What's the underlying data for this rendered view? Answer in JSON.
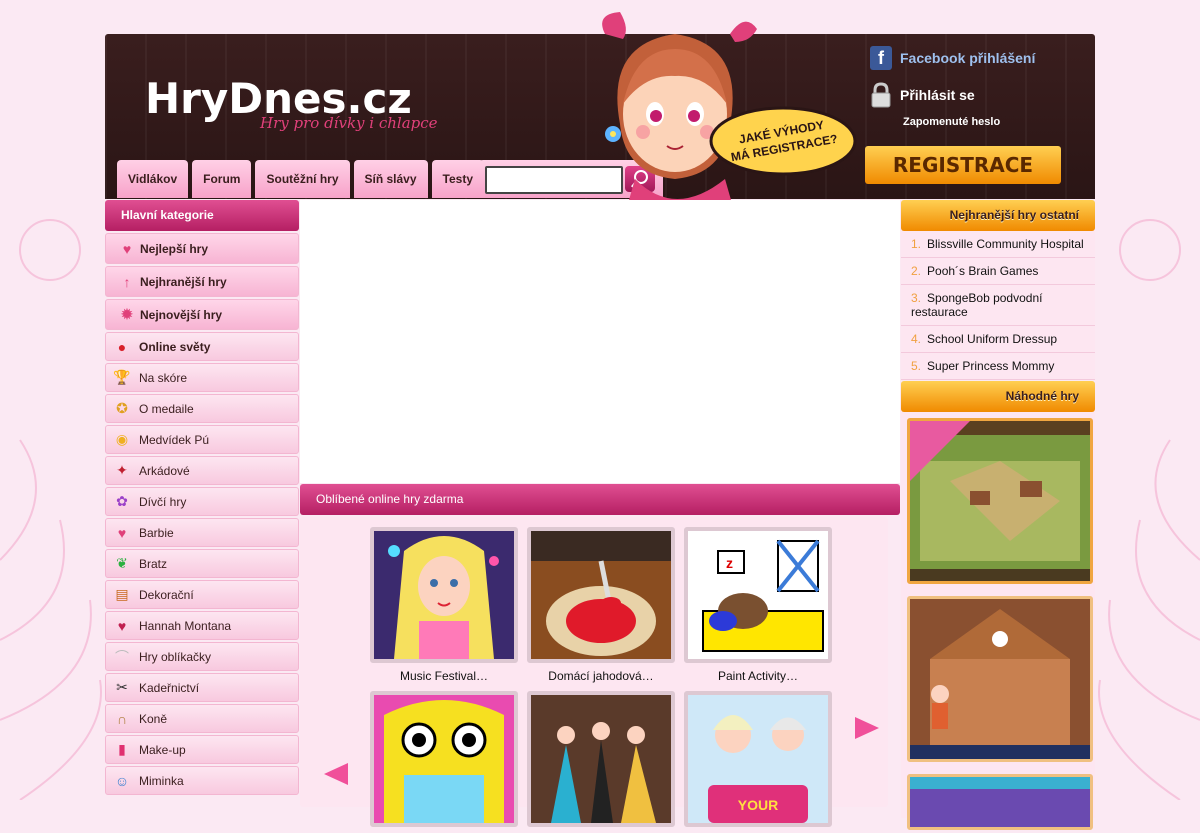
{
  "site": {
    "logo": "HryDnes.cz",
    "tagline": "Hry pro dívky i chlapce"
  },
  "nav": {
    "items": [
      "Vidlákov",
      "Forum",
      "Soutěžní hry",
      "Síň slávy",
      "Testy"
    ],
    "search_placeholder": ""
  },
  "bubble_text": [
    "JAKÉ VÝHODY",
    "MÁ REGISTRACE?"
  ],
  "login": {
    "facebook": "Facebook přihlášení",
    "login": "Přihlásit se",
    "forgot": "Zapomenuté heslo",
    "register": "REGISTRACE"
  },
  "left": {
    "heading": "Hlavní kategorie",
    "top_items": [
      {
        "label": "Nejlepší hry",
        "icon": "heart-icon"
      },
      {
        "label": "Nejhranější hry",
        "icon": "arrow-up-icon"
      },
      {
        "label": "Nejnovější hry",
        "icon": "star-burst-icon"
      }
    ],
    "items": [
      {
        "label": "Online světy",
        "icon": "angry-bird-icon",
        "bold": true
      },
      {
        "label": "Na skóre",
        "icon": "trophy-icon"
      },
      {
        "label": "O medaile",
        "icon": "medal-icon"
      },
      {
        "label": "Medvídek Pú",
        "icon": "honey-pot-icon"
      },
      {
        "label": "Arkádové",
        "icon": "joystick-icon"
      },
      {
        "label": "Dívčí hry",
        "icon": "flower-icon"
      },
      {
        "label": "Barbie",
        "icon": "heart-badge-icon"
      },
      {
        "label": "Bratz",
        "icon": "butterfly-icon"
      },
      {
        "label": "Dekorační",
        "icon": "palette-icon"
      },
      {
        "label": "Hannah Montana",
        "icon": "heart-guitar-icon"
      },
      {
        "label": "Hry oblíkačky",
        "icon": "shoes-icon"
      },
      {
        "label": "Kadeřnictví",
        "icon": "scissors-icon"
      },
      {
        "label": "Koně",
        "icon": "horseshoe-icon"
      },
      {
        "label": "Make-up",
        "icon": "lipstick-icon"
      },
      {
        "label": "Miminka",
        "icon": "baby-icon"
      }
    ]
  },
  "center": {
    "heading": "Oblíbené online hry zdarma",
    "games": [
      {
        "title": "Music Festival…"
      },
      {
        "title": "Domácí jahodová…"
      },
      {
        "title": "Paint Activity…"
      },
      {
        "title": ""
      },
      {
        "title": ""
      },
      {
        "title": ""
      }
    ]
  },
  "right": {
    "top_heading": "Nejhranější hry ostatní",
    "top_games": [
      {
        "num": "1.",
        "title": "Blissville Community Hospital"
      },
      {
        "num": "2.",
        "title": "Pooh´s Brain Games"
      },
      {
        "num": "3.",
        "title": "SpongeBob podvodní restaurace"
      },
      {
        "num": "4.",
        "title": "School Uniform Dressup"
      },
      {
        "num": "5.",
        "title": "Super Princess Mommy"
      }
    ],
    "random_heading": "Náhodné hry"
  },
  "colors": {
    "pink_accent": "#e04f92",
    "orange_accent": "#f08a00",
    "header_bg": "#3a1e1e",
    "panel_bg": "#fde6f1"
  }
}
